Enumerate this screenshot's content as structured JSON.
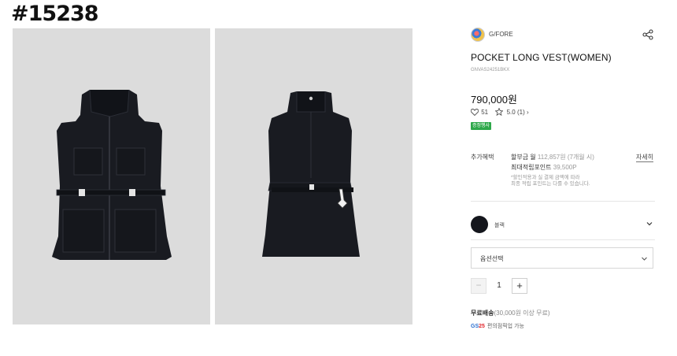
{
  "watermark": "#15238",
  "product": {
    "brand": "G/FORE",
    "title": "POCKET LONG VEST(WOMEN)",
    "code": "GNVAS24251BKX",
    "price": "790,000원",
    "likes": "51",
    "rating": "5.0",
    "review_count": "(1)",
    "review_arrow": "›",
    "badge": "증정행사"
  },
  "images": [
    {
      "name": "front-view"
    },
    {
      "name": "back-view"
    }
  ],
  "benefits": {
    "label": "추가혜택",
    "installment": "할부금 월",
    "installment_amount": "112,857원",
    "installment_note": "(7개월 시)",
    "points": "최대적립포인트",
    "points_amount": "39,500P",
    "detail_link": "자세히",
    "notice_1": "*할인적용과 실 결제 금액에 따라",
    "notice_2": "최종 적립 포인트는 다를 수 있습니다."
  },
  "color": {
    "name": "블랙",
    "swatch": "#14161c"
  },
  "option_select": {
    "label": "옵션선택"
  },
  "quantity": {
    "minus": "−",
    "value": "1",
    "plus": "+"
  },
  "shipping": {
    "label": "무료배송",
    "condition": "(30,000원 이상 무료)",
    "gs_logo_prefix": "GS",
    "gs_logo_suffix": "25",
    "pickup": "편의점픽업 가능"
  },
  "colors": {
    "badge": "#2ea84a",
    "photo_bg": "#dcdcdc",
    "garment": "#191b21"
  },
  "icons": [
    "share-icon",
    "heart-icon",
    "star-icon",
    "chevron-down-icon"
  ]
}
